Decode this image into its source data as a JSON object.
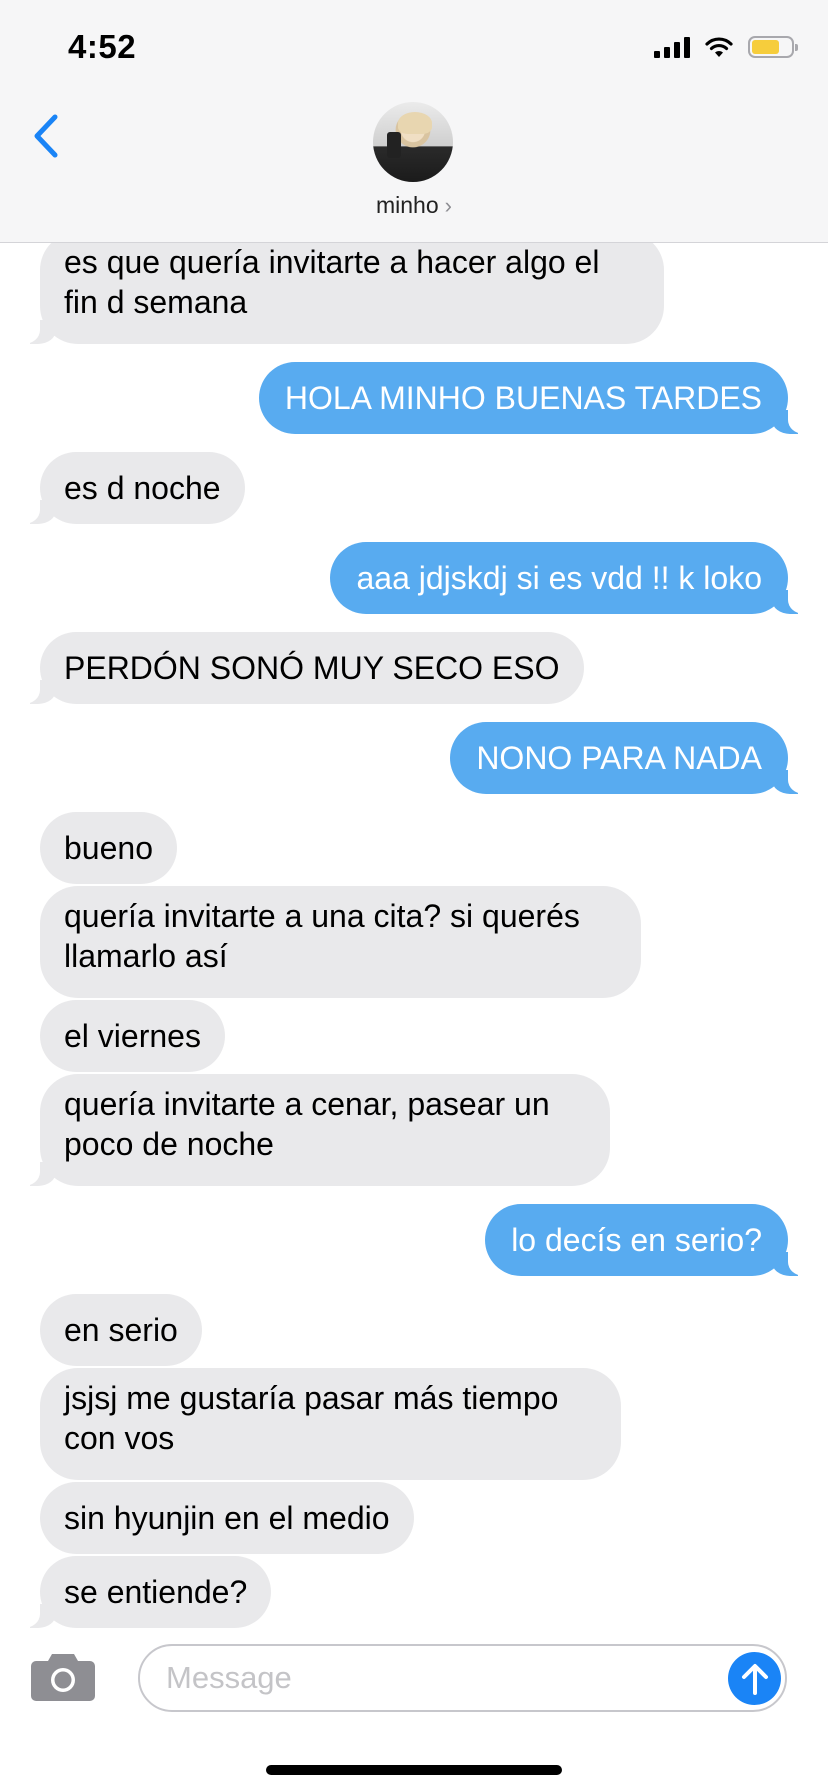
{
  "status_bar": {
    "time": "4:52"
  },
  "header": {
    "contact_name": "minho",
    "chevron": "›"
  },
  "messages": [
    {
      "side": "in",
      "text": "es que quería invitarte a hacer algo el\nfin d semana"
    },
    {
      "side": "out",
      "text": "HOLA MINHO BUENAS TARDES"
    },
    {
      "side": "in",
      "text": "es d noche"
    },
    {
      "side": "out",
      "text": "aaa jdjskdj si es vdd !! k loko"
    },
    {
      "side": "in",
      "text": "PERDÓN SONÓ MUY SECO ESO"
    },
    {
      "side": "out",
      "text": "NONO PARA NADA"
    },
    {
      "side": "in",
      "text": "bueno"
    },
    {
      "side": "in",
      "text": "quería invitarte a una cita? si querés\nllamarlo así"
    },
    {
      "side": "in",
      "text": "el viernes"
    },
    {
      "side": "in",
      "text": "quería invitarte a cenar, pasear un\npoco de noche"
    },
    {
      "side": "out",
      "text": "lo decís en serio?"
    },
    {
      "side": "in",
      "text": "en serio"
    },
    {
      "side": "in",
      "text": "jsjsj me gustaría pasar más tiempo\ncon vos"
    },
    {
      "side": "in",
      "text": "sin hyunjin en el medio"
    },
    {
      "side": "in",
      "text": "se entiende?"
    }
  ],
  "input_bar": {
    "placeholder": "Message",
    "value": ""
  },
  "icons": {
    "back": "chevron-left-icon",
    "camera": "camera-icon",
    "send": "arrow-up-icon",
    "signal": "cellular-signal-icon",
    "wifi": "wifi-icon",
    "battery": "battery-icon"
  },
  "colors": {
    "incoming_bubble": "#e9e9eb",
    "outgoing_bubble": "#58abf0",
    "accent": "#1a84f6",
    "battery_fill": "#f6cd3c"
  }
}
